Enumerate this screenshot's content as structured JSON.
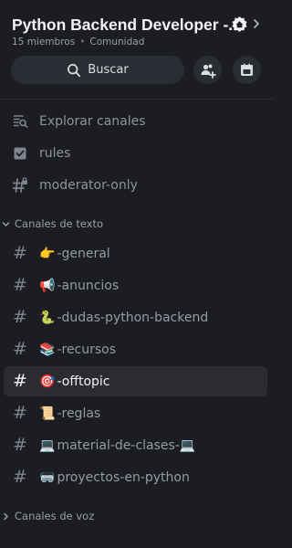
{
  "server": {
    "name": "Python Backend Developer -...",
    "members": "15 miembros",
    "separator": "•",
    "type": "Comunidad"
  },
  "actions": {
    "search_label": "Buscar"
  },
  "quick_links": [
    {
      "label": "Explorar canales",
      "icon": "explore-channels-icon"
    },
    {
      "label": "rules",
      "icon": "rules-checkbox-icon"
    },
    {
      "label": "moderator-only",
      "icon": "hash-lock-icon"
    }
  ],
  "categories": {
    "text": "Canales de texto",
    "voice": "Canales de voz"
  },
  "text_channels": [
    {
      "emoji": "👉",
      "name": "-general",
      "active": false
    },
    {
      "emoji": "📢",
      "name": "-anuncios",
      "active": false
    },
    {
      "emoji": "🐍",
      "name": "-dudas-python-backend",
      "active": false
    },
    {
      "emoji": "📚",
      "name": "-recursos",
      "active": false
    },
    {
      "emoji": "🎯",
      "name": "-offtopic",
      "active": true
    },
    {
      "emoji": "📜",
      "name": "-reglas",
      "active": false
    },
    {
      "emoji": "💻",
      "name": "material-de-clases-💻",
      "active": false
    },
    {
      "emoji": "🥽",
      "name": "proyectos-en-python",
      "active": false
    }
  ],
  "colors": {
    "background": "#1c1d22",
    "button": "#2b2d34",
    "active_row": "#2a2c32",
    "text_primary": "#f2f3f5",
    "text_muted": "#949ba4"
  }
}
